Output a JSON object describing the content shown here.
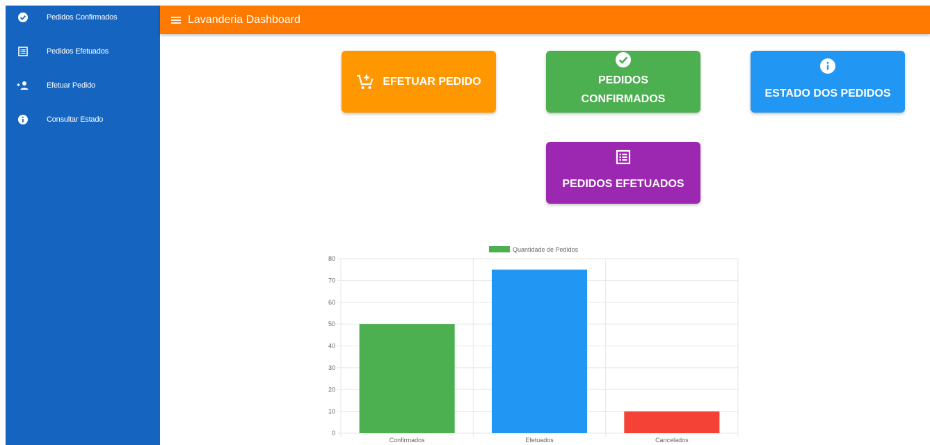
{
  "sidebar": {
    "items": [
      {
        "label": "Pedidos Confirmados",
        "icon": "check-circle-icon"
      },
      {
        "label": "Pedidos Efetuados",
        "icon": "list-alt-icon"
      },
      {
        "label": "Efetuar Pedido",
        "icon": "person-add-icon"
      },
      {
        "label": "Consultar Estado",
        "icon": "info-icon"
      }
    ],
    "background": "#1565c0"
  },
  "header": {
    "title": "Lavanderia Dashboard",
    "menu_icon": "menu-icon",
    "background": "#ff7a00"
  },
  "cards": {
    "efetuar": {
      "label": "EFETUAR PEDIDO",
      "icon": "cart-plus-icon",
      "color": "#ff9800"
    },
    "confirmados": {
      "label_line1": "PEDIDOS",
      "label_line2": "CONFIRMADOS",
      "icon": "check-circle-icon",
      "color": "#4caf50"
    },
    "estado": {
      "label": "ESTADO DOS PEDIDOS",
      "icon": "info-icon",
      "color": "#2196f3"
    },
    "efetuados": {
      "label": "PEDIDOS EFETUADOS",
      "icon": "list-alt-icon",
      "color": "#9c27b0"
    }
  },
  "chart_data": {
    "type": "bar",
    "categories": [
      "Confirmados",
      "Efetuados",
      "Cancelados"
    ],
    "series": [
      {
        "name": "Quantidade de Pedidos",
        "values": [
          50,
          75,
          10
        ],
        "colors": [
          "#4caf50",
          "#2196f3",
          "#f44336"
        ]
      }
    ],
    "ylim": [
      0,
      80
    ],
    "yticks": [
      0,
      10,
      20,
      30,
      40,
      50,
      60,
      70,
      80
    ],
    "grid": true,
    "legend": "top-center",
    "legend_color": "#4caf50"
  }
}
